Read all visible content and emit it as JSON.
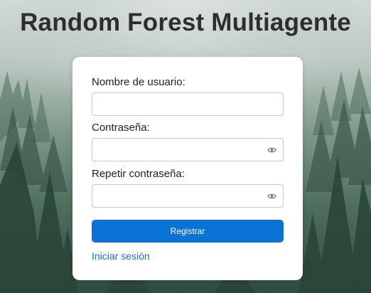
{
  "page": {
    "title": "Random Forest Multiagente"
  },
  "form": {
    "username": {
      "label": "Nombre de usuario:",
      "value": "",
      "placeholder": ""
    },
    "password": {
      "label": "Contraseña:",
      "value": "",
      "placeholder": ""
    },
    "repeat_password": {
      "label": "Repetir contraseña:",
      "value": "",
      "placeholder": ""
    },
    "submit_label": "Registrar",
    "login_link": "Iniciar sesión"
  },
  "icons": {
    "show_password": "eye-icon"
  },
  "colors": {
    "primary": "#0a74d6",
    "link": "#1670c9",
    "title": "#2e2e2e",
    "card": "#ffffff"
  }
}
